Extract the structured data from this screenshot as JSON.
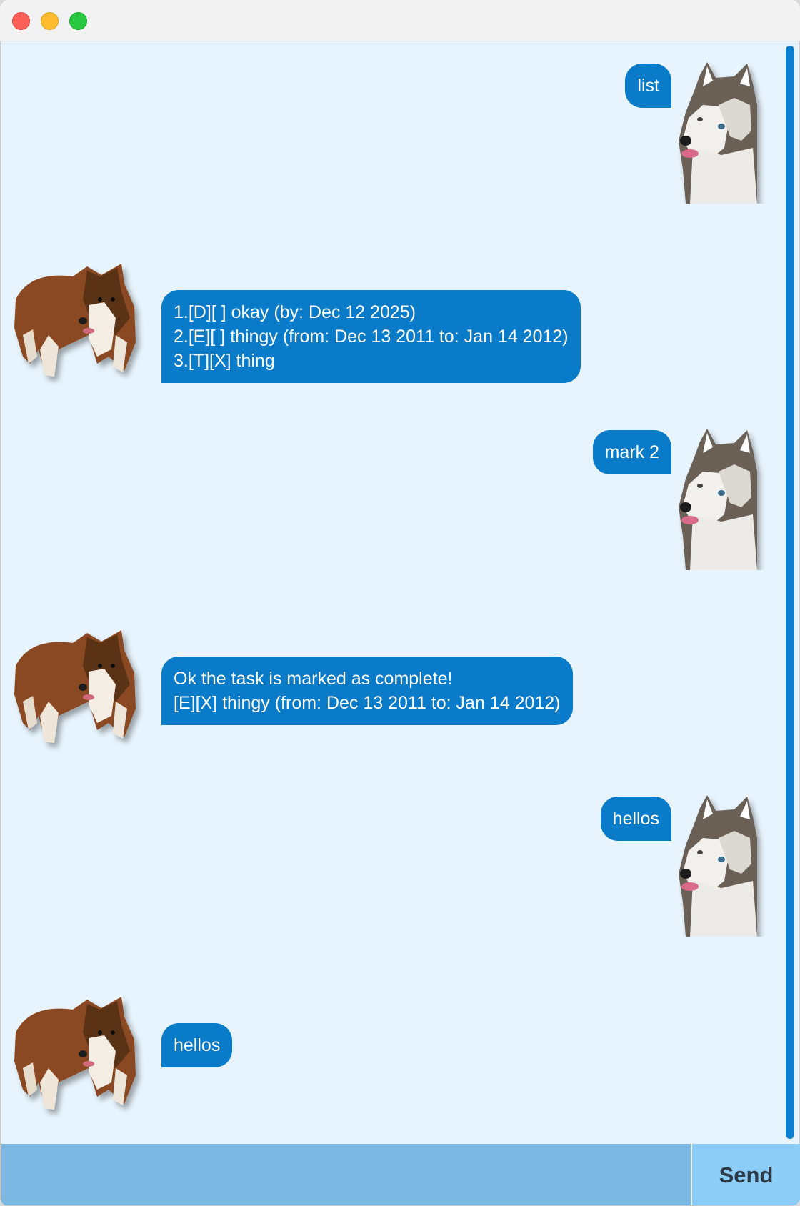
{
  "window": {
    "controls": [
      "close",
      "minimize",
      "zoom"
    ]
  },
  "messages": [
    {
      "sender": "user",
      "lines": [
        "list"
      ]
    },
    {
      "sender": "bot",
      "lines": [
        "1.[D][ ] okay (by: Dec 12 2025)",
        "2.[E][ ] thingy (from: Dec 13 2011 to: Jan 14 2012)",
        "3.[T][X] thing"
      ]
    },
    {
      "sender": "user",
      "lines": [
        "mark 2"
      ]
    },
    {
      "sender": "bot",
      "lines": [
        "Ok the task is marked as complete!",
        "[E][X] thingy (from: Dec 13 2011 to: Jan 14 2012)"
      ]
    },
    {
      "sender": "user",
      "lines": [
        "hellos"
      ]
    },
    {
      "sender": "bot",
      "lines": [
        "hellos"
      ]
    }
  ],
  "avatars": {
    "user": "husky-dog-avatar",
    "bot": "sheltie-dog-avatar"
  },
  "input": {
    "value": "",
    "placeholder": ""
  },
  "send_button": {
    "label": "Send"
  },
  "colors": {
    "bubble": "#0a7bc8",
    "background": "#e8f4fd",
    "input": "#7db8e3",
    "send": "#8ccdf7",
    "scrollbar": "#0a7fd0"
  }
}
